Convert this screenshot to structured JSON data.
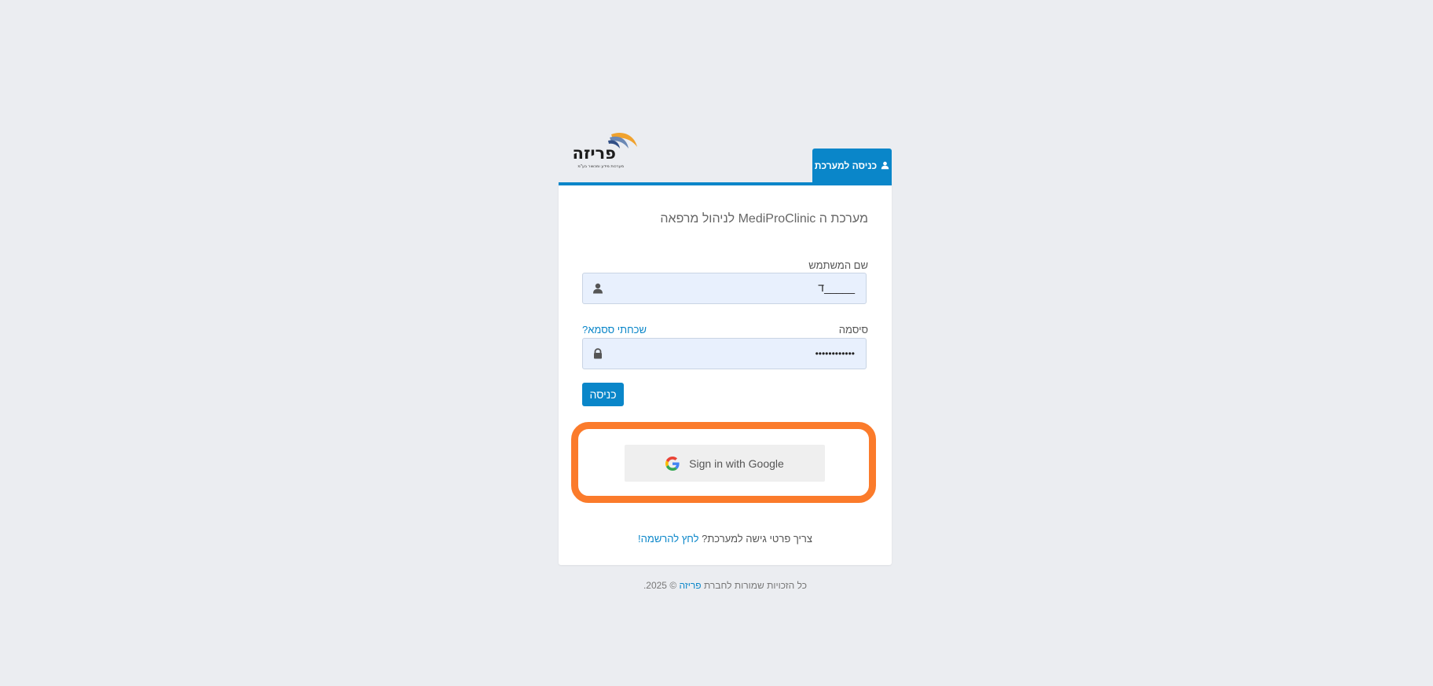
{
  "header": {
    "logo_text": "פריזה",
    "logo_tagline": "מערכות מידע ומכשור בע\"מ",
    "tab_label": "כניסה למערכת"
  },
  "form": {
    "headline": "מערכת ה MediProClinic לניהול מרפאה",
    "username_label": "שם המשתמש",
    "username_value": "ד_____",
    "password_label": "סיסמה",
    "password_value": "••••••••••••",
    "forgot_link": "שכחתי ססמא?",
    "login_button": "כניסה"
  },
  "google_sign_in": {
    "label": "Sign in with Google",
    "highlight_color": "#fb7b2b"
  },
  "register": {
    "prompt": "צריך פרטי גישה למערכת?",
    "link": "לחץ להרשמה!"
  },
  "footer": {
    "prefix": "כל הזכויות שמורות לחברת",
    "company": "פריזה",
    "suffix": "© 2025."
  },
  "colors": {
    "accent": "#0a86c9",
    "background": "#ebedf1",
    "input_bg": "#e8f0fd"
  },
  "icons": {
    "tab": "user-icon",
    "username": "user-icon",
    "password": "lock-icon",
    "google": "google-logo-icon"
  }
}
